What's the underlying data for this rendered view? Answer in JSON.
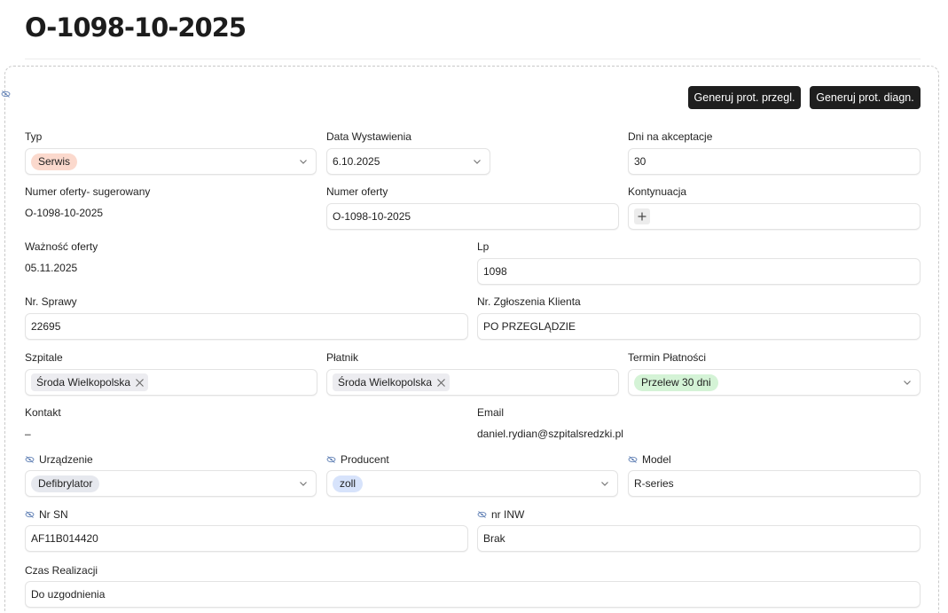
{
  "page": {
    "title": "O-1098-10-2025"
  },
  "actions": {
    "gen_prot_przegl": "Generuj prot. przegl.",
    "gen_prot_diagn": "Generuj prot. diagn."
  },
  "fields": {
    "typ": {
      "label": "Typ",
      "value": "Serwis",
      "chip_color": "#fbd9cd"
    },
    "data_wystawienia": {
      "label": "Data Wystawienia",
      "value": "6.10.2025"
    },
    "dni_na_akceptacje": {
      "label": "Dni na akceptacje",
      "value": "30"
    },
    "numer_oferty_sugerowany": {
      "label": "Numer oferty- sugerowany",
      "value": "O-1098-10-2025"
    },
    "numer_oferty": {
      "label": "Numer oferty",
      "value": "O-1098-10-2025"
    },
    "kontynuacja": {
      "label": "Kontynuacja",
      "value": ""
    },
    "waznosc_oferty": {
      "label": "Ważność oferty",
      "value": "05.11.2025"
    },
    "lp": {
      "label": "Lp",
      "value": "1098"
    },
    "nr_sprawy": {
      "label": "Nr. Sprawy",
      "value": "22695"
    },
    "nr_zgloszenia_klienta": {
      "label": "Nr. Zgłoszenia Klienta",
      "value": "PO PRZEGLĄDZIE"
    },
    "szpitale": {
      "label": "Szpitale",
      "value": "Środa Wielkopolska"
    },
    "platnik": {
      "label": "Płatnik",
      "value": "Środa Wielkopolska"
    },
    "termin_platnosci": {
      "label": "Termin Płatności",
      "value": "Przelew 30 dni",
      "chip_color": "#d4f3d6"
    },
    "kontakt": {
      "label": "Kontakt",
      "value": "–"
    },
    "email": {
      "label": "Email",
      "value": "daniel.rydian@szpitalsredzki.pl"
    },
    "urzadzenie": {
      "label": "Urządzenie",
      "value": "Defibrylator",
      "chip_color": "#e6e8ee"
    },
    "producent": {
      "label": "Producent",
      "value": "zoll",
      "chip_color": "#d7e3fb"
    },
    "model": {
      "label": "Model",
      "value": "R-series"
    },
    "nr_sn": {
      "label": "Nr SN",
      "value": "AF11B014420"
    },
    "nr_inw": {
      "label": "nr INW",
      "value": "Brak"
    },
    "czas_realizacji": {
      "label": "Czas Realizacji",
      "value": "Do uzgodnienia"
    }
  },
  "icons": {
    "hidden_field": "eye-slash-icon",
    "dropdown": "chevron-down-icon",
    "remove_tag": "close-icon",
    "add": "plus-icon"
  },
  "colors": {
    "primary_button": "#1e1e1e",
    "hidden_icon": "#5f7fb4"
  }
}
